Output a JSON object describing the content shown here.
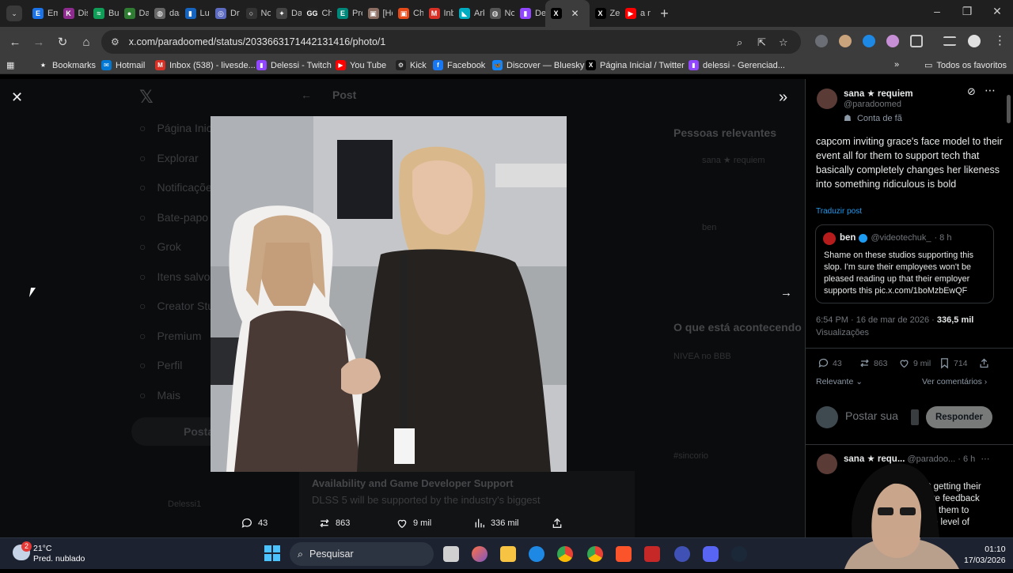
{
  "browser": {
    "tabs": [
      {
        "label": "Em",
        "color": "#1a73e8",
        "glyph": "E"
      },
      {
        "label": "Dis",
        "color": "#8e2b8f",
        "glyph": "K"
      },
      {
        "label": "Bus",
        "color": "#0f9d58",
        "glyph": "≈"
      },
      {
        "label": "Da",
        "color": "#2e7d32",
        "glyph": "●"
      },
      {
        "label": "das",
        "color": "#666666",
        "glyph": "◍"
      },
      {
        "label": "Lur",
        "color": "#1565c0",
        "glyph": "▮"
      },
      {
        "label": "Dr",
        "color": "#5c6bc0",
        "glyph": "◎"
      },
      {
        "label": "No",
        "color": "#333333",
        "glyph": "○"
      },
      {
        "label": "Da",
        "color": "#444444",
        "glyph": "✦"
      },
      {
        "label": "Ch",
        "color": "#222222",
        "glyph": "GG"
      },
      {
        "label": "Pre",
        "color": "#00897b",
        "glyph": "E"
      },
      {
        "label": "[Ho",
        "color": "#8d6e63",
        "glyph": "▣"
      },
      {
        "label": "Ch",
        "color": "#e64a19",
        "glyph": "▣"
      },
      {
        "label": "Inb",
        "color": "#d93025",
        "glyph": "M"
      },
      {
        "label": "Ark",
        "color": "#00acc1",
        "glyph": "◣"
      },
      {
        "label": "No",
        "color": "#555555",
        "glyph": "◍"
      },
      {
        "label": "Del",
        "color": "#9146ff",
        "glyph": "▮"
      },
      {
        "label": "",
        "color": "#000000",
        "glyph": "X",
        "active": true
      },
      {
        "label": "Zer",
        "color": "#000000",
        "glyph": "X"
      },
      {
        "label": "a n",
        "color": "#ff0000",
        "glyph": "▶"
      }
    ],
    "url": "x.com/paradoomed/status/2033663171442131416/photo/1",
    "bookmarks": [
      {
        "label": "Bookmarks",
        "color": "#3c3c3c",
        "glyph": "★"
      },
      {
        "label": "Hotmail",
        "color": "#0078d4",
        "glyph": "✉"
      },
      {
        "label": "Inbox (538) - livesde...",
        "color": "#d93025",
        "glyph": "M"
      },
      {
        "label": "Delessi - Twitch",
        "color": "#9146ff",
        "glyph": "▮"
      },
      {
        "label": "You Tube",
        "color": "#ff0000",
        "glyph": "▶"
      },
      {
        "label": "Kick",
        "color": "#222222",
        "glyph": "⚙"
      },
      {
        "label": "Facebook",
        "color": "#1877f2",
        "glyph": "f"
      },
      {
        "label": "Discover — Bluesky",
        "color": "#1185fe",
        "glyph": "🦋"
      },
      {
        "label": "Página Inicial / Twitter",
        "color": "#000000",
        "glyph": "X"
      },
      {
        "label": "delessi - Gerenciad...",
        "color": "#9146ff",
        "glyph": "▮"
      }
    ],
    "all_bookmarks_label": "Todos os favoritos"
  },
  "backdrop": {
    "header": "Post",
    "nav": [
      "Página Inicial",
      "Explorar",
      "Notificações",
      "Bate-papo",
      "Grok",
      "Itens salvos",
      "Creator Studio",
      "Premium",
      "Perfil",
      "Mais"
    ],
    "post_button": "Postar",
    "right_heading": "Pessoas relevantes",
    "right_heading2": "O que está acontecendo",
    "trend1": "NIVEA no BBB",
    "trend2": "#sincorio",
    "card_title": "Availability and Game Developer Support",
    "card_text": "DLSS 5 will be supported by the industry's biggest",
    "profile_name": "Delessi1",
    "bg_name1": "sana ★ requiem",
    "bg_name2": "ben"
  },
  "viewer": {
    "actions": [
      {
        "icon": "reply-icon",
        "count": "43"
      },
      {
        "icon": "repost-icon",
        "count": "863"
      },
      {
        "icon": "like-icon",
        "count": "9 mil"
      },
      {
        "icon": "views-icon",
        "count": "336 mil"
      },
      {
        "icon": "share-icon",
        "count": ""
      }
    ]
  },
  "tweet": {
    "author_name": "sana ★ requiem",
    "author_handle": "@paradoomed",
    "author_badge": "Conta de fã",
    "text": "capcom inviting grace's face model to their event all for them to support tech that basically completely changes her likeness into something ridiculous is bold",
    "translate_label": "Traduzir post",
    "quote": {
      "name": "ben",
      "handle": "@videotechuk_",
      "time": "· 8 h",
      "text": "Shame on these studios supporting this slop. I'm sure their employees won't be pleased reading up that their employer supports this pic.x.com/1boMzbEwQF"
    },
    "timestamp": "6:54 PM · 16 de mar de 2026 ·",
    "views": "336,5 mil",
    "views_label": "Visualizações",
    "stats": {
      "replies": "43",
      "reposts": "863",
      "likes": "9 mil",
      "bookmarks": "714"
    },
    "sort_label": "Relevante",
    "see_replies": "Ver comentários",
    "reply_placeholder": "Postar sua",
    "reply_button": "Responder",
    "reply_preview": {
      "name": "sana ★ requ...",
      "handle": "@paradoo...",
      "time": "· 6 h",
      "lines": [
        "bout getting their",
        "to give feedback",
        "ce for them to",
        "nsane level of"
      ]
    }
  },
  "taskbar": {
    "temperature": "21°C",
    "weather": "Pred. nublado",
    "weather_badge": "2",
    "search_label": "Pesquisar",
    "time": "01:10",
    "date": "17/03/2026"
  }
}
